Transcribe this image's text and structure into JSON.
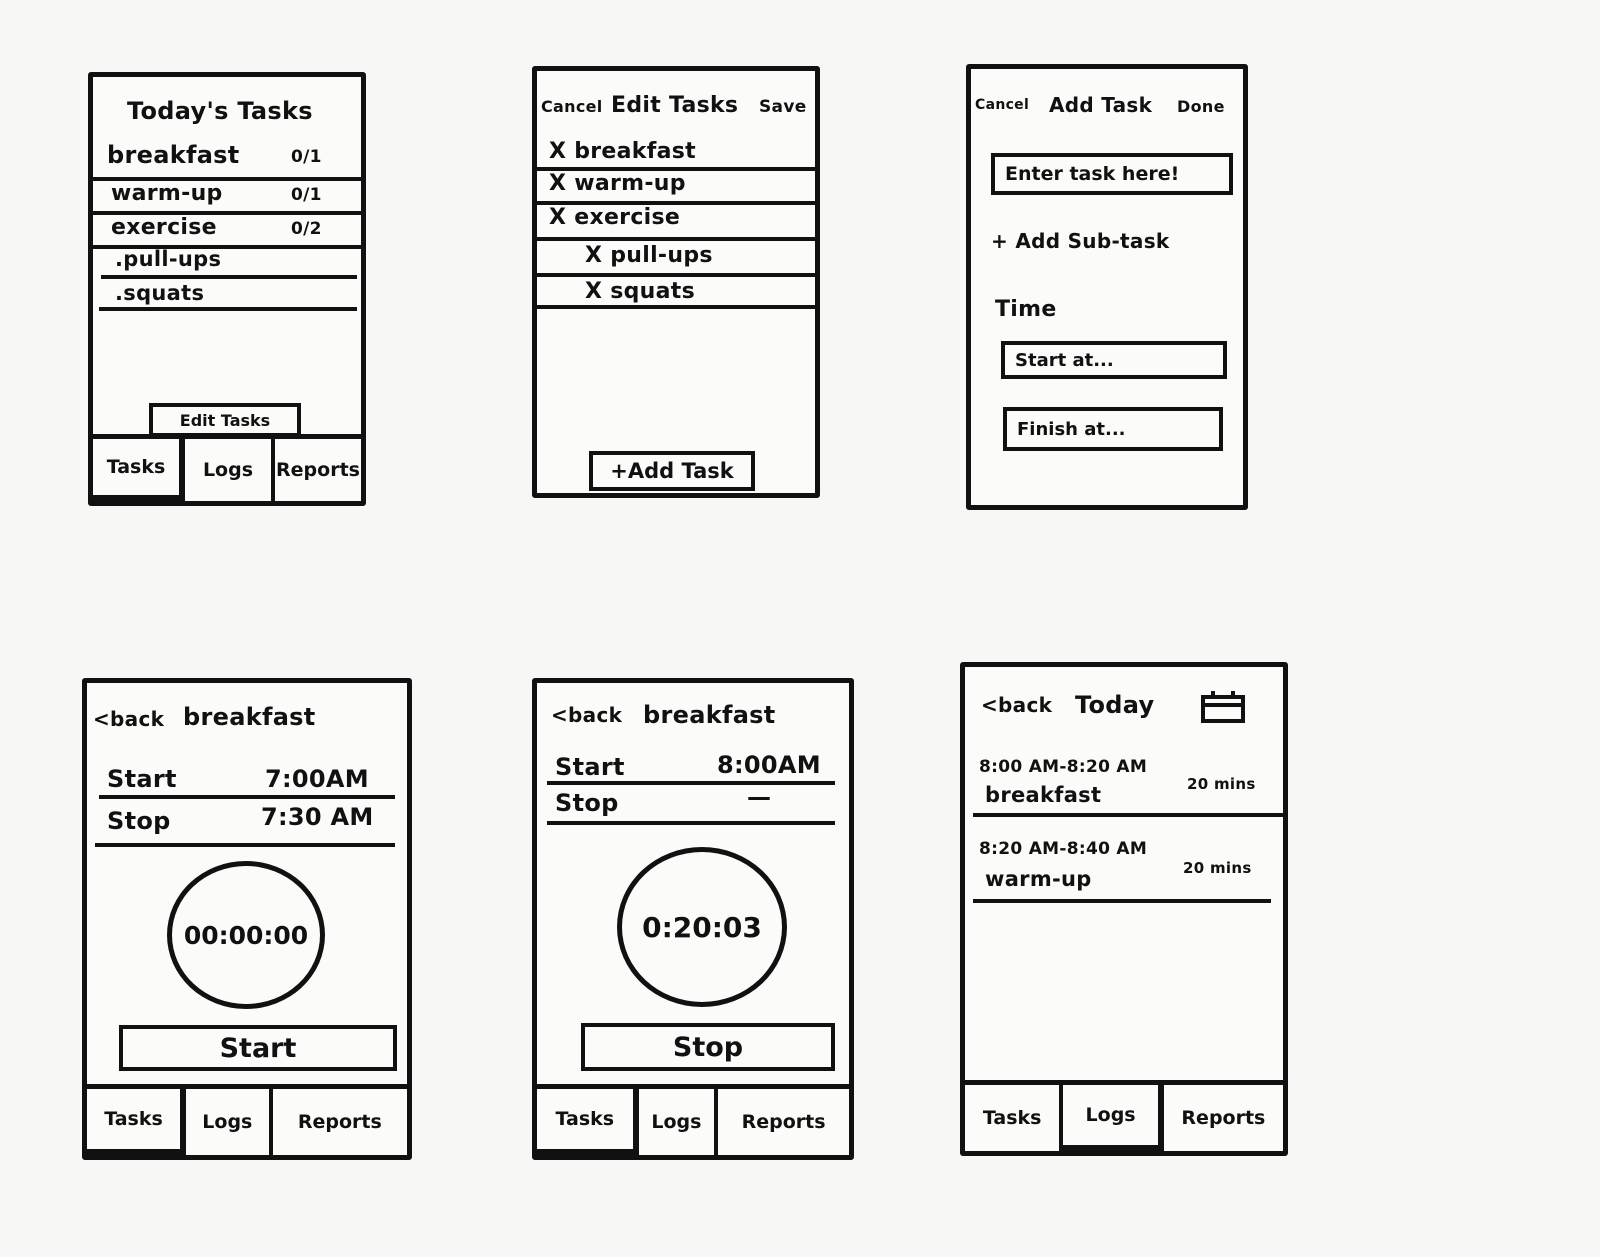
{
  "today_tasks": {
    "title": "Today's Tasks",
    "tasks": [
      {
        "name": "breakfast",
        "count": "0/1"
      },
      {
        "name": "warm-up",
        "count": "0/1"
      },
      {
        "name": "exercise",
        "count": "0/2"
      }
    ],
    "subtasks": [
      ".pull-ups",
      ".squats"
    ],
    "edit_button": "Edit Tasks",
    "tabs": [
      "Tasks",
      "Logs",
      "Reports"
    ]
  },
  "edit_tasks": {
    "cancel": "Cancel",
    "title": "Edit Tasks",
    "save": "Save",
    "delete_mark": "X",
    "items": [
      "breakfast",
      "warm-up",
      "exercise",
      "pull-ups",
      "squats"
    ],
    "add_button": "+Add Task"
  },
  "add_task": {
    "cancel": "Cancel",
    "title": "Add Task",
    "done": "Done",
    "task_placeholder": "Enter task here!",
    "add_subtask": "+ Add Sub-task",
    "time_label": "Time",
    "start_placeholder": "Start at...",
    "finish_placeholder": "Finish at..."
  },
  "timer_done": {
    "back": "<back",
    "title": "breakfast",
    "start_label": "Start",
    "start_value": "7:00AM",
    "stop_label": "Stop",
    "stop_value": "7:30 AM",
    "timer": "00:00:00",
    "button": "Start",
    "tabs": [
      "Tasks",
      "Logs",
      "Reports"
    ]
  },
  "timer_running": {
    "back": "<back",
    "title": "breakfast",
    "start_label": "Start",
    "start_value": "8:00AM",
    "stop_label": "Stop",
    "stop_value": "—",
    "timer": "0:20:03",
    "button": "Stop",
    "tabs": [
      "Tasks",
      "Logs",
      "Reports"
    ]
  },
  "logs": {
    "back": "<back",
    "title": "Today",
    "entries": [
      {
        "range": "8:00 AM-8:20 AM",
        "task": "breakfast",
        "duration": "20 mins"
      },
      {
        "range": "8:20 AM-8:40 AM",
        "task": "warm-up",
        "duration": "20 mins"
      }
    ],
    "tabs": [
      "Tasks",
      "Logs",
      "Reports"
    ]
  }
}
